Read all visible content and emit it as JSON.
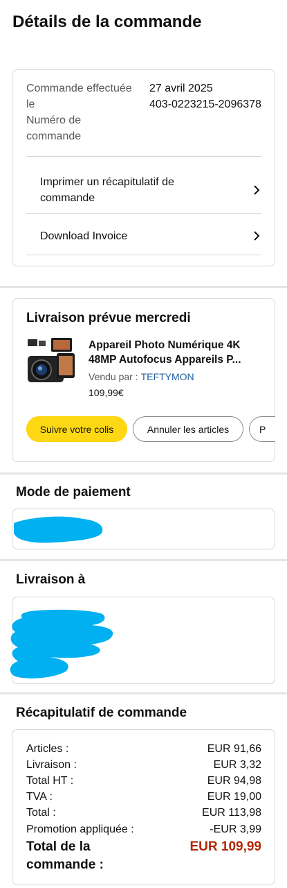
{
  "page": {
    "title": "Détails de la commande"
  },
  "order": {
    "placed_label": "Commande effectuée le",
    "placed_value": "27 avril 2025",
    "number_label": "Numéro de commande",
    "number_value": "403-0223215-2096378",
    "links": [
      {
        "label": "Imprimer un récapitulatif de commande",
        "icon": "chevron-right-icon"
      },
      {
        "label": "Download Invoice",
        "icon": "chevron-right-icon"
      }
    ]
  },
  "delivery": {
    "title": "Livraison prévue mercredi",
    "product": {
      "name_line1": "Appareil Photo Numérique 4K",
      "name_line2": "48MP Autofocus Appareils P...",
      "sold_by_label": "Vendu par :",
      "seller": "TEFTYMON",
      "price": "109,99€",
      "thumbnail_icon": "camera-product-thumbnail"
    },
    "buttons": {
      "track": "Suivre votre colis",
      "cancel": "Annuler les articles",
      "more": "P"
    }
  },
  "payment": {
    "title": "Mode de paiement"
  },
  "shipping": {
    "title": "Livraison à"
  },
  "summary": {
    "title": "Récapitulatif de commande",
    "rows": [
      {
        "label": "Articles :",
        "value": "EUR 91,66"
      },
      {
        "label": "Livraison :",
        "value": "EUR 3,32"
      },
      {
        "label": "Total HT :",
        "value": "EUR 94,98"
      },
      {
        "label": "TVA :",
        "value": "EUR 19,00"
      },
      {
        "label": "Total :",
        "value": "EUR 113,98"
      },
      {
        "label": "Promotion appliquée :",
        "value": "-EUR 3,99"
      }
    ],
    "total_label": "Total de la commande :",
    "total_value": "EUR 109,99"
  },
  "colors": {
    "accent_yellow": "#ffd814",
    "price_red": "#b12704",
    "link_blue": "#2162a1",
    "redaction_blue": "#00b0f0"
  }
}
